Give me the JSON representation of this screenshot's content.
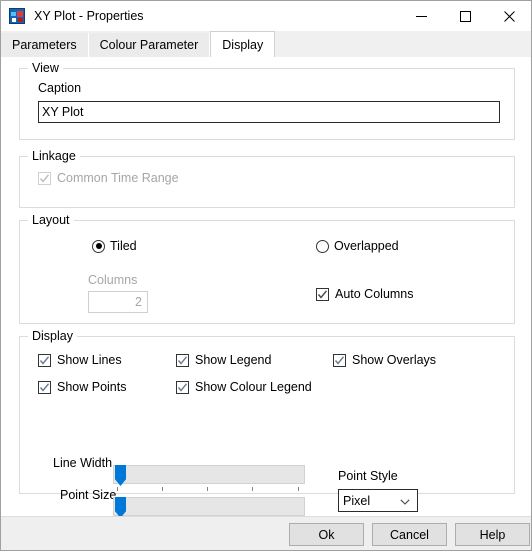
{
  "window": {
    "title": "XY Plot - Properties",
    "icon": "app-icon",
    "controls": {
      "minimize": "minimize-icon",
      "maximize": "maximize-icon",
      "close": "close-icon"
    }
  },
  "tabs": [
    {
      "label": "Parameters",
      "active": false
    },
    {
      "label": "Colour Parameter",
      "active": false
    },
    {
      "label": "Display",
      "active": true
    }
  ],
  "groups": {
    "view": {
      "title": "View",
      "caption_label": "Caption",
      "caption_value": "XY Plot"
    },
    "linkage": {
      "title": "Linkage",
      "common_time_range": {
        "label": "Common Time Range",
        "checked": true,
        "enabled": false
      }
    },
    "layout": {
      "title": "Layout",
      "tiled": {
        "label": "Tiled",
        "selected": true
      },
      "overlapped": {
        "label": "Overlapped",
        "selected": false
      },
      "columns_label": "Columns",
      "columns_value": "2",
      "columns_enabled": false,
      "auto_columns": {
        "label": "Auto Columns",
        "checked": true,
        "enabled": true
      }
    },
    "display": {
      "title": "Display",
      "checkboxes": [
        {
          "label": "Show Lines",
          "checked": true
        },
        {
          "label": "Show Legend",
          "checked": true
        },
        {
          "label": "Show Overlays",
          "checked": true
        },
        {
          "label": "Show Points",
          "checked": true
        },
        {
          "label": "Show Colour Legend",
          "checked": true
        }
      ],
      "line_width": {
        "label": "Line Width",
        "value_pct": 3
      },
      "point_size": {
        "label": "Point Size",
        "value_pct": 3
      },
      "point_style": {
        "label": "Point Style",
        "value": "Pixel",
        "options": [
          "Pixel"
        ]
      }
    }
  },
  "footer": {
    "ok": "Ok",
    "cancel": "Cancel",
    "help": "Help"
  },
  "colors": {
    "accent": "#0078d7",
    "window_bg": "#ffffff",
    "footer_bg": "#efefef",
    "group_border": "#dcdcdc",
    "disabled_text": "#a6a6a6"
  }
}
